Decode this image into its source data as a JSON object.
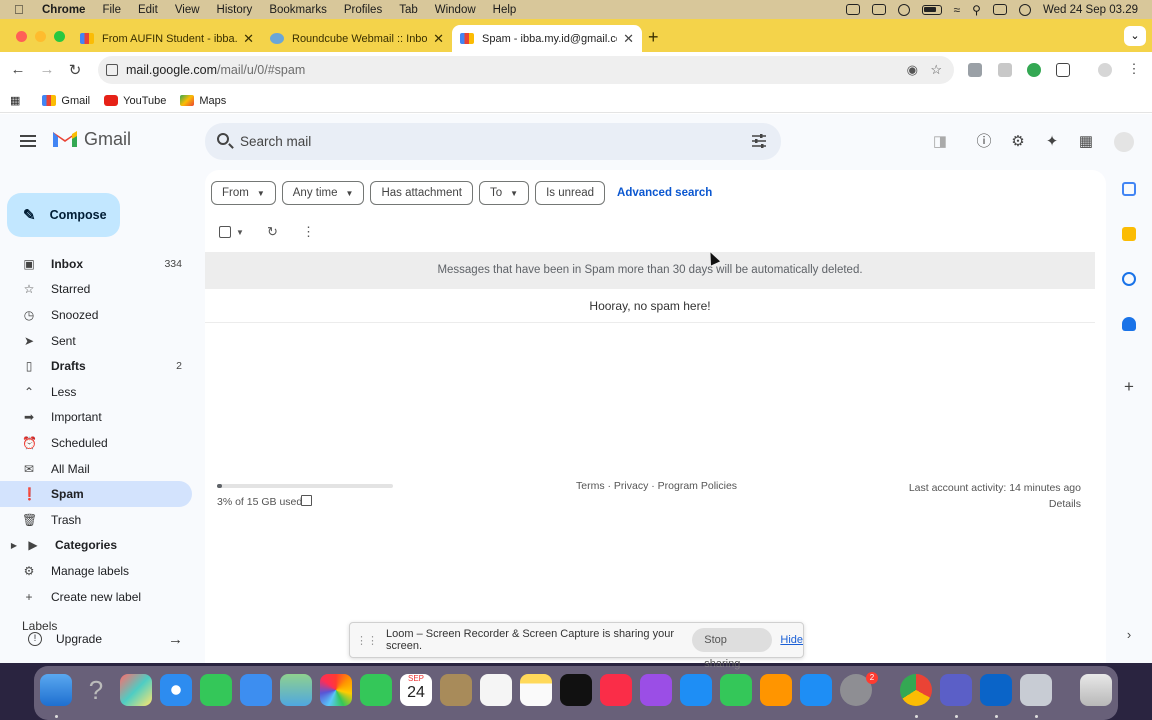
{
  "menubar": {
    "app": "Chrome",
    "items": [
      "File",
      "Edit",
      "View",
      "History",
      "Bookmarks",
      "Profiles",
      "Tab",
      "Window",
      "Help"
    ],
    "clock": "Wed 24 Sep  03.29"
  },
  "browser": {
    "tabs": [
      {
        "title": "From AUFIN Student - ibba.my",
        "icon": "gmail-icon",
        "active": false
      },
      {
        "title": "Roundcube Webmail :: Inbox",
        "icon": "roundcube-icon",
        "active": false
      },
      {
        "title": "Spam - ibba.my.id@gmail.com",
        "icon": "gmail-icon",
        "active": true
      }
    ],
    "url_host": "mail.google.com",
    "url_path": "/mail/u/0/#spam",
    "bookmarks": [
      {
        "label": "Gmail",
        "icon": "gmail-icon"
      },
      {
        "label": "YouTube",
        "icon": "youtube-icon"
      },
      {
        "label": "Maps",
        "icon": "maps-icon"
      }
    ]
  },
  "gmail": {
    "logo_text": "Gmail",
    "search_placeholder": "Search mail",
    "compose_label": "Compose",
    "nav": [
      {
        "label": "Inbox",
        "icon": "inbox-icon",
        "count": "334",
        "bold": true
      },
      {
        "label": "Starred",
        "icon": "star-icon",
        "count": ""
      },
      {
        "label": "Snoozed",
        "icon": "clock-icon",
        "count": ""
      },
      {
        "label": "Sent",
        "icon": "send-icon",
        "count": ""
      },
      {
        "label": "Drafts",
        "icon": "draft-icon",
        "count": "2",
        "bold": true
      },
      {
        "label": "Less",
        "icon": "chevron-up-icon",
        "count": ""
      },
      {
        "label": "Important",
        "icon": "important-icon",
        "count": ""
      },
      {
        "label": "Scheduled",
        "icon": "scheduled-icon",
        "count": ""
      },
      {
        "label": "All Mail",
        "icon": "all-mail-icon",
        "count": ""
      },
      {
        "label": "Spam",
        "icon": "spam-icon",
        "count": "",
        "selected": true
      },
      {
        "label": "Trash",
        "icon": "trash-icon",
        "count": ""
      },
      {
        "label": "Categories",
        "icon": "caret-right-icon",
        "count": "",
        "bold": true
      },
      {
        "label": "Manage labels",
        "icon": "gear-icon",
        "count": ""
      },
      {
        "label": "Create new label",
        "icon": "plus-icon",
        "count": ""
      }
    ],
    "labels_heading": "Labels",
    "upgrade_label": "Upgrade",
    "filter_chips": [
      {
        "label": "From",
        "dropdown": true
      },
      {
        "label": "Any time",
        "dropdown": true
      },
      {
        "label": "Has attachment",
        "dropdown": false
      },
      {
        "label": "To",
        "dropdown": true
      },
      {
        "label": "Is unread",
        "dropdown": false
      }
    ],
    "advanced_search": "Advanced search",
    "spam_banner": "Messages that have been in Spam more than 30 days will be automatically deleted.",
    "empty_message": "Hooray, no spam here!",
    "storage_text": "3% of 15 GB used",
    "storage_fraction": 0.03,
    "footer_links": "Terms · Privacy · Program Policies",
    "last_activity": "Last account activity: 14 minutes ago",
    "details_link": "Details"
  },
  "loom": {
    "message": "Loom – Screen Recorder & Screen Capture is sharing your screen.",
    "stop_label": "Stop sharing",
    "hide_label": "Hide"
  },
  "dock": {
    "calendar_month": "SEP",
    "calendar_day": "24",
    "badge": "2"
  },
  "colors": {
    "tabstrip": "#f4d34a",
    "selected_nav": "#d3e3fd",
    "compose": "#c2e7ff",
    "link": "#0b57d0"
  }
}
